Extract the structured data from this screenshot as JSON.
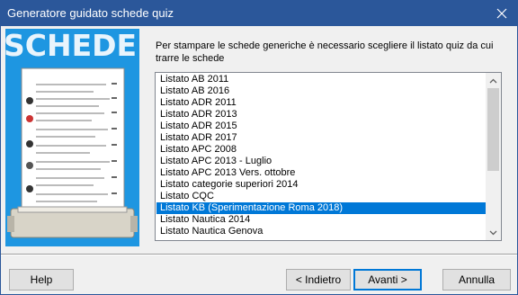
{
  "window": {
    "title": "Generatore guidato schede quiz"
  },
  "side_image": {
    "heading": "SCHEDE"
  },
  "instruction": "Per stampare le schede generiche è necessario scegliere il listato quiz da cui trarre le schede",
  "list": {
    "items": [
      "Listato AB 2011",
      "Listato AB 2016",
      "Listato ADR 2011",
      "Listato ADR 2013",
      "Listato ADR 2015",
      "Listato ADR 2017",
      "Listato APC 2008",
      "Listato APC 2013 - Luglio",
      "Listato APC 2013 Vers. ottobre",
      "Listato categorie superiori 2014",
      "Listato CQC",
      "Listato KB (Sperimentazione Roma 2018)",
      "Listato Nautica 2014",
      "Listato Nautica Genova"
    ],
    "selected": "Listato KB (Sperimentazione Roma 2018)"
  },
  "buttons": {
    "help": "Help",
    "back": "< Indietro",
    "next": "Avanti >",
    "cancel": "Annulla"
  },
  "colors": {
    "titlebar": "#2b579a",
    "selection": "#0078d7",
    "side_image": "#1e96e1"
  },
  "icons": [
    "close-icon",
    "scroll-up-icon",
    "scroll-down-icon"
  ]
}
